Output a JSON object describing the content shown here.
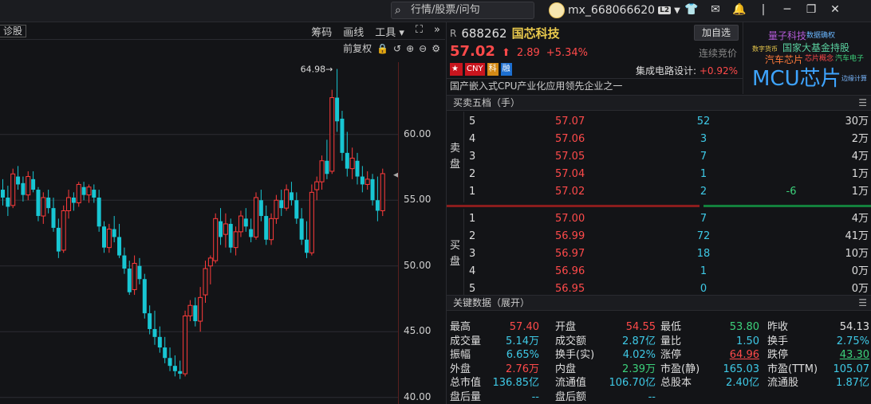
{
  "topbar": {
    "search_placeholder": "行情/股票/问句",
    "username": "mx_668066620",
    "level": "L2",
    "icons": [
      "menu-caret-icon",
      "tshirt-icon",
      "mail-icon",
      "mail-caret-icon",
      "bell-icon",
      "minimize-icon",
      "restore-icon",
      "close-icon"
    ]
  },
  "chart_panel": {
    "left_tag": "诊股",
    "tools": [
      "筹码",
      "画线",
      "工具 ▾"
    ],
    "adjust": "前复权",
    "max_label": "64.98"
  },
  "chart_data": {
    "type": "candlestick",
    "y_ticks": [
      "60.00",
      "55.00",
      "50.00",
      "45.00",
      "40.00"
    ],
    "ylim": [
      39.5,
      65.5
    ],
    "annotation": "64.98",
    "last_close": 57.02,
    "candles": [
      [
        55.8,
        56.6,
        54.6,
        55.2
      ],
      [
        55.2,
        56.1,
        53.8,
        54.5
      ],
      [
        54.6,
        57.4,
        54.4,
        57.0
      ],
      [
        56.8,
        57.6,
        55.8,
        56.2
      ],
      [
        56.3,
        56.8,
        54.9,
        55.4
      ],
      [
        55.4,
        57.2,
        55.0,
        56.8
      ],
      [
        56.6,
        57.2,
        55.6,
        55.8
      ],
      [
        55.8,
        56.0,
        53.4,
        53.8
      ],
      [
        53.8,
        55.6,
        53.2,
        55.2
      ],
      [
        55.2,
        55.8,
        54.0,
        54.4
      ],
      [
        54.4,
        55.2,
        52.6,
        52.9
      ],
      [
        52.9,
        53.6,
        50.6,
        51.1
      ],
      [
        51.2,
        54.6,
        51.0,
        54.2
      ],
      [
        54.2,
        55.8,
        53.6,
        55.2
      ],
      [
        55.2,
        55.6,
        54.2,
        54.8
      ],
      [
        54.8,
        56.4,
        54.5,
        56.2
      ],
      [
        56.0,
        56.4,
        55.0,
        55.4
      ],
      [
        55.4,
        56.2,
        54.8,
        56.0
      ],
      [
        55.8,
        56.2,
        54.8,
        55.2
      ],
      [
        55.2,
        55.8,
        52.6,
        53.0
      ],
      [
        53.0,
        53.4,
        51.0,
        51.4
      ],
      [
        51.4,
        53.2,
        51.0,
        52.8
      ],
      [
        52.8,
        53.8,
        51.8,
        52.2
      ],
      [
        52.2,
        53.2,
        50.6,
        50.8
      ],
      [
        50.8,
        51.4,
        49.4,
        49.8
      ],
      [
        49.8,
        50.4,
        47.8,
        48.0
      ],
      [
        48.2,
        50.8,
        47.8,
        50.2
      ],
      [
        50.0,
        50.6,
        48.6,
        49.0
      ],
      [
        49.0,
        49.4,
        46.0,
        46.4
      ],
      [
        46.4,
        47.0,
        44.8,
        45.2
      ],
      [
        45.2,
        46.6,
        44.0,
        44.6
      ],
      [
        44.6,
        45.4,
        43.4,
        43.8
      ],
      [
        43.8,
        44.6,
        42.6,
        43.0
      ],
      [
        43.0,
        43.8,
        42.0,
        42.4
      ],
      [
        42.4,
        43.2,
        41.6,
        42.0
      ],
      [
        42.0,
        42.8,
        41.4,
        41.8
      ],
      [
        41.8,
        46.6,
        41.6,
        46.2
      ],
      [
        46.2,
        47.4,
        45.8,
        47.0
      ],
      [
        47.0,
        47.6,
        45.4,
        45.8
      ],
      [
        45.8,
        48.4,
        45.0,
        47.6
      ],
      [
        47.8,
        50.4,
        47.2,
        49.8
      ],
      [
        50.0,
        50.8,
        48.6,
        50.6
      ],
      [
        50.4,
        54.0,
        50.2,
        53.6
      ],
      [
        53.4,
        54.4,
        51.6,
        52.2
      ],
      [
        52.4,
        54.0,
        51.4,
        53.2
      ],
      [
        53.2,
        53.6,
        51.0,
        51.4
      ],
      [
        51.4,
        53.0,
        50.8,
        52.6
      ],
      [
        52.6,
        54.2,
        52.2,
        53.8
      ],
      [
        53.6,
        54.4,
        52.6,
        53.0
      ],
      [
        52.8,
        53.6,
        51.8,
        52.2
      ],
      [
        52.2,
        55.6,
        52.0,
        55.2
      ],
      [
        55.0,
        55.8,
        53.4,
        53.8
      ],
      [
        53.8,
        54.6,
        51.6,
        52.0
      ],
      [
        52.0,
        54.0,
        51.6,
        53.6
      ],
      [
        53.6,
        55.4,
        53.2,
        55.0
      ],
      [
        55.0,
        55.8,
        53.8,
        54.4
      ],
      [
        54.4,
        56.2,
        54.2,
        55.8
      ],
      [
        55.6,
        56.4,
        54.6,
        55.0
      ],
      [
        55.0,
        55.6,
        53.2,
        53.6
      ],
      [
        53.6,
        54.4,
        51.6,
        52.0
      ],
      [
        52.0,
        53.4,
        50.6,
        51.0
      ],
      [
        51.0,
        56.2,
        50.8,
        55.6
      ],
      [
        55.8,
        56.8,
        55.0,
        56.4
      ],
      [
        56.4,
        58.4,
        55.8,
        58.0
      ],
      [
        58.0,
        59.6,
        56.6,
        57.0
      ],
      [
        57.2,
        63.4,
        57.0,
        62.8
      ],
      [
        62.8,
        64.98,
        60.2,
        61.0
      ],
      [
        61.2,
        61.8,
        58.0,
        58.6
      ],
      [
        58.6,
        60.2,
        56.8,
        57.4
      ],
      [
        57.4,
        59.0,
        56.6,
        58.2
      ],
      [
        58.0,
        58.6,
        56.2,
        56.8
      ],
      [
        56.8,
        57.6,
        55.6,
        56.2
      ],
      [
        56.2,
        57.2,
        55.8,
        56.6
      ],
      [
        56.6,
        57.0,
        54.6,
        55.0
      ],
      [
        55.0,
        56.8,
        53.4,
        54.2
      ],
      [
        54.2,
        57.4,
        53.8,
        57.02
      ]
    ]
  },
  "quote": {
    "market_tag": "R",
    "code": "688262",
    "name": "国芯科技",
    "add_btn": "加自选",
    "price": "57.02",
    "change": "2.89",
    "pct": "+5.34%",
    "auction": "连续竞价",
    "flags": [
      "CNY",
      "科",
      "融"
    ],
    "sector": "集成电路设计:",
    "sector_pct": "+0.92%",
    "desc": "国产嵌入式CPU产业化应用领先企业之一"
  },
  "cloud": {
    "words": [
      "量子科技",
      "数字货币",
      "国家大基金持股",
      "汽车芯片",
      "芯片概念",
      "汽车电子",
      "MCU芯片",
      "边缘计算",
      "数据确权"
    ]
  },
  "orderbook": {
    "title": "买卖五档（手）",
    "sell_label": [
      "卖",
      "盘"
    ],
    "buy_label": [
      "买",
      "盘"
    ],
    "sell": [
      [
        "5",
        "57.07",
        "52",
        "",
        "30万"
      ],
      [
        "4",
        "57.06",
        "3",
        "",
        "2万"
      ],
      [
        "3",
        "57.05",
        "7",
        "",
        "4万"
      ],
      [
        "2",
        "57.04",
        "1",
        "",
        "1万"
      ],
      [
        "1",
        "57.02",
        "2",
        "-6",
        "1万"
      ]
    ],
    "buy": [
      [
        "1",
        "57.00",
        "7",
        "",
        "4万"
      ],
      [
        "2",
        "56.99",
        "72",
        "",
        "41万"
      ],
      [
        "3",
        "56.97",
        "18",
        "",
        "10万"
      ],
      [
        "4",
        "56.96",
        "1",
        "",
        "0万"
      ],
      [
        "5",
        "56.95",
        "0",
        "",
        "0万"
      ]
    ]
  },
  "keydata": {
    "title": "关键数据（展开）",
    "rows": [
      [
        [
          "最高",
          "57.40",
          "red"
        ],
        [
          "开盘",
          "54.55",
          "red"
        ],
        [
          "最低",
          "53.80",
          "green"
        ],
        [
          "昨收",
          "54.13",
          "white"
        ]
      ],
      [
        [
          "成交量",
          "5.14万",
          "cyan"
        ],
        [
          "成交额",
          "2.87亿",
          "cyan"
        ],
        [
          "量比",
          "1.50",
          "cyan"
        ],
        [
          "换手",
          "2.75%",
          "cyan"
        ]
      ],
      [
        [
          "振幅",
          "6.65%",
          "cyan"
        ],
        [
          "换手(实)",
          "4.02%",
          "cyan"
        ],
        [
          "涨停",
          "64.96",
          "red ul"
        ],
        [
          "跌停",
          "43.30",
          "green ul"
        ]
      ],
      [
        [
          "外盘",
          "2.76万",
          "red"
        ],
        [
          "内盘",
          "2.39万",
          "green"
        ],
        [
          "市盈(静)",
          "165.03",
          "cyan"
        ],
        [
          "市盈(TTM)",
          "105.07",
          "cyan"
        ]
      ],
      [
        [
          "总市值",
          "136.85亿",
          "cyan"
        ],
        [
          "流通值",
          "106.70亿",
          "cyan"
        ],
        [
          "总股本",
          "2.40亿",
          "cyan"
        ],
        [
          "流通股",
          "1.87亿",
          "cyan"
        ]
      ],
      [
        [
          "盘后量",
          "--",
          "cyan"
        ],
        [
          "盘后额",
          "--",
          "cyan"
        ]
      ]
    ]
  }
}
